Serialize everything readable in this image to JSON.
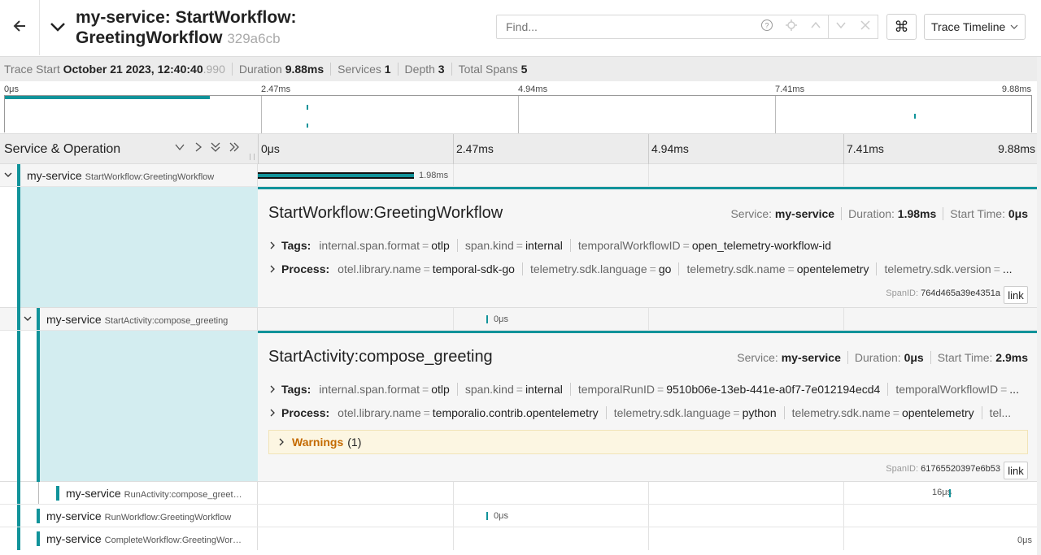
{
  "header": {
    "title_line1": "my-service: StartWorkflow:",
    "title_line2": "GreetingWorkflow",
    "trace_id": "329a6cb",
    "find_placeholder": "Find...",
    "view_mode": "Trace Timeline",
    "icons": [
      "back-arrow-icon",
      "chevron-down-icon",
      "help-icon",
      "locate-icon",
      "chevron-up-icon",
      "chevron-down-icon",
      "close-icon",
      "command-icon"
    ]
  },
  "meta": {
    "trace_start_label": "Trace Start",
    "trace_start_value": "October 21 2023, 12:40:40",
    "trace_start_ms": ".990",
    "duration_label": "Duration",
    "duration_value": "9.88ms",
    "services_label": "Services",
    "services_value": "1",
    "depth_label": "Depth",
    "depth_value": "3",
    "total_spans_label": "Total Spans",
    "total_spans_value": "5"
  },
  "minimap": {
    "ticks": [
      "0μs",
      "2.47ms",
      "4.94ms",
      "7.41ms",
      "9.88ms"
    ]
  },
  "columns": {
    "title": "Service & Operation",
    "ticks": [
      "0μs",
      "2.47ms",
      "4.94ms",
      "7.41ms",
      "9.88ms"
    ]
  },
  "spans": [
    {
      "service": "my-service",
      "operation": "StartWorkflow:GreetingWorkflow",
      "duration": "1.98ms",
      "detail": {
        "title": "StartWorkflow:GreetingWorkflow",
        "service_label": "Service:",
        "service_value": "my-service",
        "duration_label": "Duration:",
        "duration_value": "1.98ms",
        "start_label": "Start Time:",
        "start_value": "0μs",
        "tags_label": "Tags:",
        "tags": [
          {
            "k": "internal.span.format",
            "v": "otlp"
          },
          {
            "k": "span.kind",
            "v": "internal"
          },
          {
            "k": "temporalWorkflowID",
            "v": "open_telemetry-workflow-id"
          }
        ],
        "process_label": "Process:",
        "process": [
          {
            "k": "otel.library.name",
            "v": "temporal-sdk-go"
          },
          {
            "k": "telemetry.sdk.language",
            "v": "go"
          },
          {
            "k": "telemetry.sdk.name",
            "v": "opentelemetry"
          },
          {
            "k": "telemetry.sdk.version",
            "v": "..."
          }
        ],
        "spanid_label": "SpanID:",
        "spanid_value": "764d465a39e4351a",
        "link_label": "link"
      }
    },
    {
      "service": "my-service",
      "operation": "StartActivity:compose_greeting",
      "duration": "0μs",
      "detail": {
        "title": "StartActivity:compose_greeting",
        "service_label": "Service:",
        "service_value": "my-service",
        "duration_label": "Duration:",
        "duration_value": "0μs",
        "start_label": "Start Time:",
        "start_value": "2.9ms",
        "tags_label": "Tags:",
        "tags": [
          {
            "k": "internal.span.format",
            "v": "otlp"
          },
          {
            "k": "span.kind",
            "v": "internal"
          },
          {
            "k": "temporalRunID",
            "v": "9510b06e-13eb-441e-a0f7-7e012194ecd4"
          },
          {
            "k": "temporalWorkflowID",
            "v": "..."
          }
        ],
        "process_label": "Process:",
        "process": [
          {
            "k": "otel.library.name",
            "v": "temporalio.contrib.opentelemetry"
          },
          {
            "k": "telemetry.sdk.language",
            "v": "python"
          },
          {
            "k": "telemetry.sdk.name",
            "v": "opentelemetry"
          },
          {
            "k": "tel...",
            "v": ""
          }
        ],
        "warnings_label": "Warnings",
        "warnings_count": "(1)",
        "spanid_label": "SpanID:",
        "spanid_value": "61765520397e6b53",
        "link_label": "link"
      }
    },
    {
      "service": "my-service",
      "operation": "RunActivity:compose_greet…",
      "duration": "16μs"
    },
    {
      "service": "my-service",
      "operation": "RunWorkflow:GreetingWorkflow",
      "duration": "0μs"
    },
    {
      "service": "my-service",
      "operation": "CompleteWorkflow:GreetingWor…",
      "duration": "0μs"
    }
  ],
  "colors": {
    "accent": "#11939a",
    "detail_fill": "#d3edf0",
    "warning": "#c46a00"
  }
}
